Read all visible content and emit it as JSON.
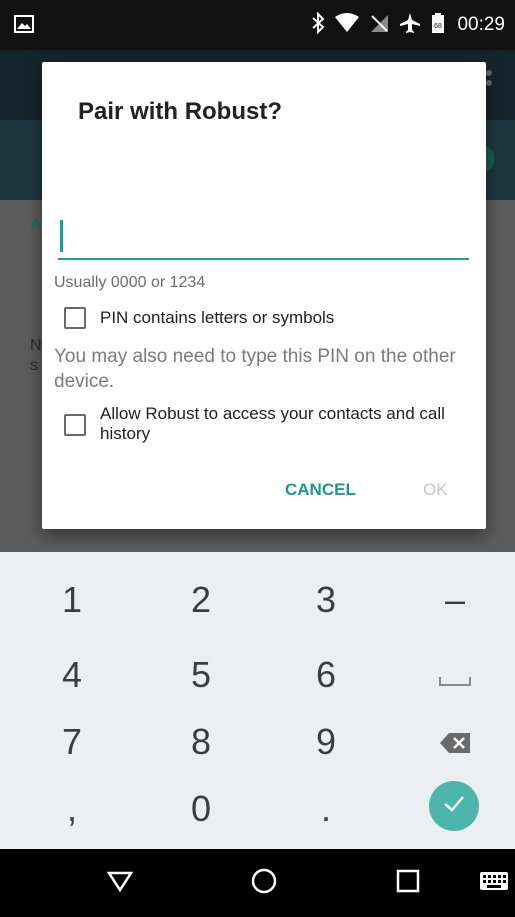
{
  "status_bar": {
    "time": "00:29"
  },
  "dialog": {
    "title": "Pair with Robust?",
    "pin_value": "",
    "hint": "Usually 0000 or 1234",
    "checkbox_letters_label": "PIN contains letters or symbols",
    "info_text": "You may also need to type this PIN on the other device.",
    "checkbox_contacts_label": "Allow Robust to access your contacts and call history",
    "cancel_label": "CANCEL",
    "ok_label": "OK"
  },
  "keypad": {
    "keys": [
      "1",
      "2",
      "3",
      "–",
      "4",
      "5",
      "6",
      "␣",
      "7",
      "8",
      "9",
      "⌫",
      ",",
      "0",
      ".",
      "✓"
    ]
  },
  "colors": {
    "accent": "#1aa192",
    "enter_key": "#4db6ac",
    "dialog_bg": "#ffffff",
    "keypad_bg": "#eceff1"
  },
  "background": {
    "section_letter": "A",
    "side_letters": "N\ns"
  }
}
